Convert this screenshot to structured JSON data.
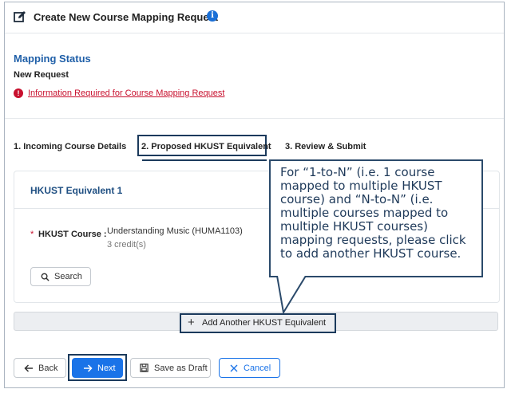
{
  "header": {
    "title": "Create New Course Mapping Request",
    "info_glyph": "i"
  },
  "status": {
    "heading": "Mapping Status",
    "value": "New Request",
    "warning_glyph": "!",
    "warning_link": "Information Required for Course Mapping Request"
  },
  "tabs": [
    {
      "label": "1. Incoming Course Details",
      "active": false
    },
    {
      "label": "2. Proposed HKUST Equivalent",
      "active": true
    },
    {
      "label": "3. Review & Submit",
      "active": false
    }
  ],
  "equivalent": {
    "title": "HKUST Equivalent 1",
    "required_mark": "*",
    "field_label": "HKUST Course :",
    "course_name": "Understanding Music (HUMA1103)",
    "course_credit": "3 credit(s)",
    "search_label": "Search"
  },
  "add_another": {
    "icon": "+",
    "label": "Add Another HKUST Equivalent"
  },
  "footer": {
    "back_label": "Back",
    "next_label": "Next",
    "draft_label": "Save as Draft",
    "cancel_label": "Cancel"
  },
  "callout": {
    "text": "For “1-to-N” (i.e. 1 course mapped to multiple HKUST course) and “N-to-N” (i.e. multiple courses mapped to multiple HKUST courses) mapping requests, please click to add another HKUST course."
  },
  "colors": {
    "accent": "#1a73e8",
    "heading_blue": "#1f5fa8",
    "error": "#c8102e",
    "highlight_border": "#1b3a5c"
  }
}
